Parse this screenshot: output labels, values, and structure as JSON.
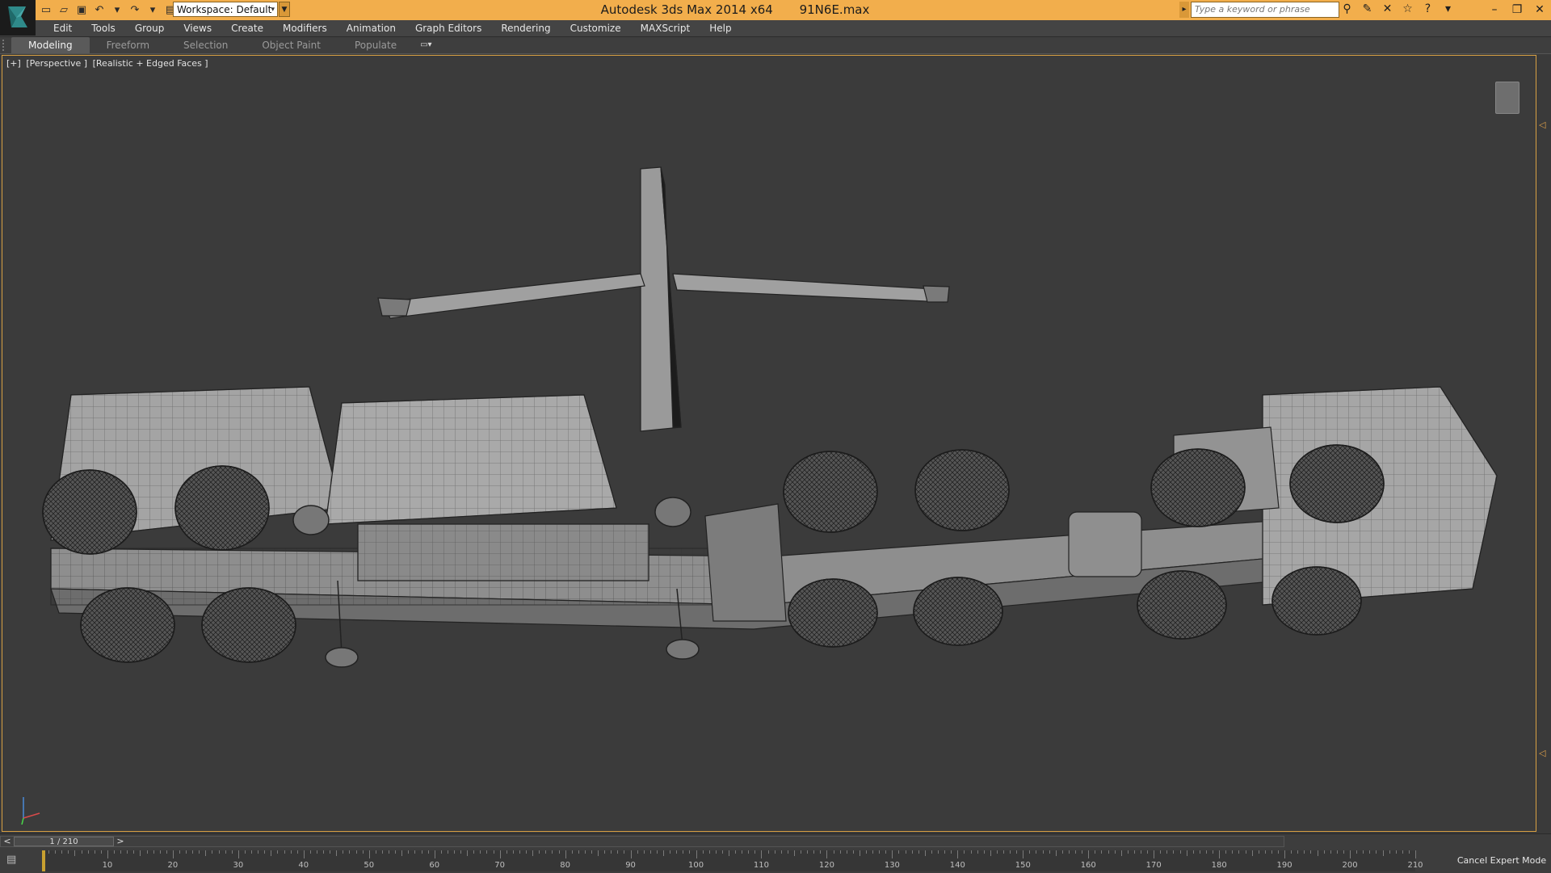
{
  "titlebar": {
    "app_name": "Autodesk 3ds Max  2014 x64",
    "file_name": "91N6E.max",
    "workspace_label": "Workspace: Default",
    "search_placeholder": "Type a keyword or phrase"
  },
  "menu": {
    "items": [
      "Edit",
      "Tools",
      "Group",
      "Views",
      "Create",
      "Modifiers",
      "Animation",
      "Graph Editors",
      "Rendering",
      "Customize",
      "MAXScript",
      "Help"
    ]
  },
  "ribbon": {
    "tabs": [
      "Modeling",
      "Freeform",
      "Selection",
      "Object Paint",
      "Populate"
    ],
    "active_tab": "Modeling"
  },
  "viewport": {
    "label_parts": [
      "[+]",
      "[Perspective ]",
      "[Realistic + Edged Faces ]"
    ]
  },
  "timeline": {
    "frame_display": "1 / 210",
    "prev_label": "<",
    "next_label": ">",
    "ticks": [
      "10",
      "20",
      "30",
      "40",
      "50",
      "60",
      "70",
      "80",
      "90",
      "100",
      "110",
      "120",
      "130",
      "140",
      "150",
      "160",
      "170",
      "180",
      "190",
      "200",
      "210"
    ],
    "current_frame": 1,
    "total_frames": 210
  },
  "status": {
    "cancel_expert_label": "Cancel Expert Mode"
  },
  "colors": {
    "titlebar": "#f2ae4c",
    "viewport_border": "#d8a043",
    "viewport_bg": "#3b3b3b"
  }
}
